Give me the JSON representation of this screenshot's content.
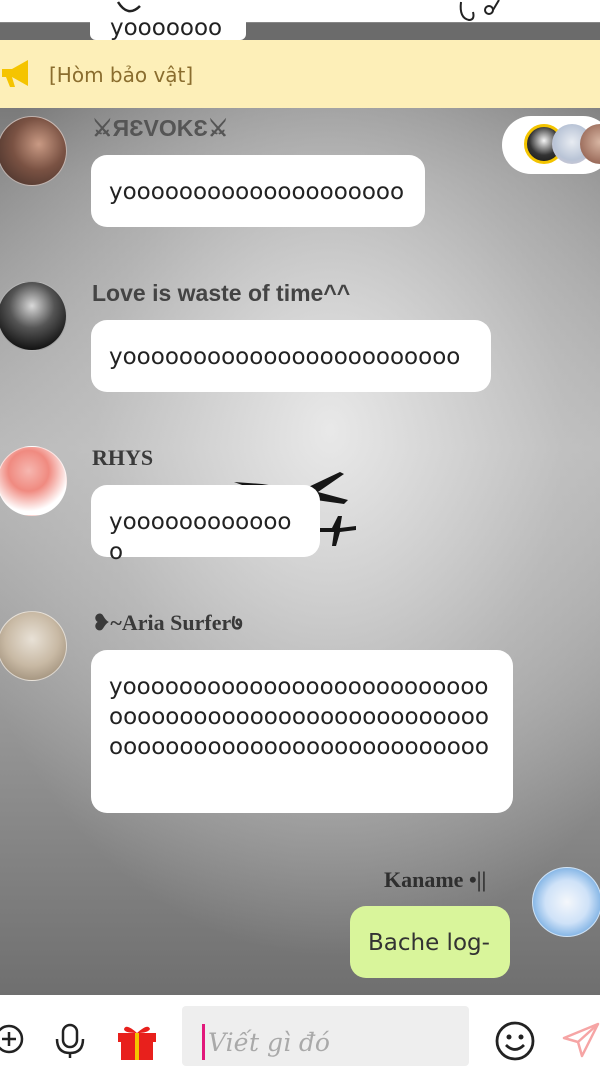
{
  "previous_message": {
    "text": "yooooooo"
  },
  "announcement": {
    "text": "[Hòm bảo vật]",
    "icon": "megaphone-icon",
    "color": "#f5c400"
  },
  "messages": [
    {
      "sender": "⚔ЯƐVOKƐ⚔",
      "text": "yoooooooooooooooooooo",
      "avatar": "user-avatar-revoke"
    },
    {
      "sender": "Love is waste of time^^",
      "text": "yoooooooooooooooooooooooo",
      "avatar": "user-avatar-love"
    },
    {
      "sender": "RHYS",
      "text": "yooooooooooooo",
      "avatar": "user-avatar-rhys"
    },
    {
      "sender": "❥~Aria Surfer७",
      "text": "yoooooooooooooooooooooooooooooooooooooooooooooooooooooooooooooooooooooooooooooooo",
      "avatar": "user-avatar-aria"
    },
    {
      "sender": "Kaname •||",
      "text": "Bache log-",
      "avatar": "user-avatar-kaname",
      "mine": true
    }
  ],
  "input": {
    "placeholder": "Viết gì đó"
  },
  "icons": {
    "add": "plus-circle-icon",
    "mic": "microphone-icon",
    "gift": "gift-icon",
    "emoji": "smiley-icon",
    "send": "send-icon"
  },
  "colors": {
    "my_bubble": "#d9f59b",
    "announcement_bg": "#fdefb8",
    "gift": "#e8201c"
  }
}
